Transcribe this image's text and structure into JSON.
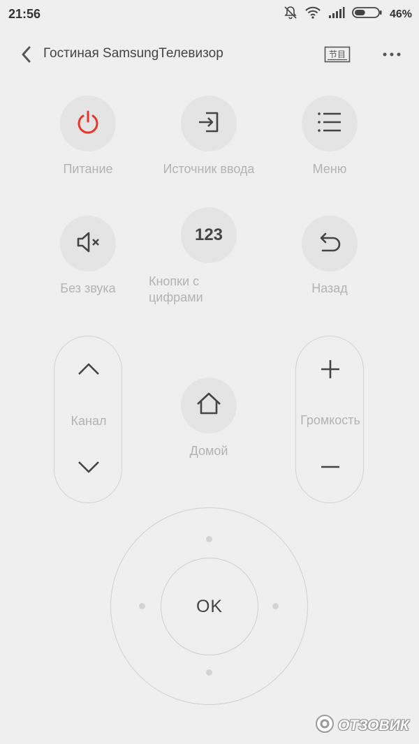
{
  "status_bar": {
    "time": "21:56",
    "battery_percent": "46%",
    "battery_level": 0.46,
    "icons": [
      "mute-bell-icon",
      "wifi-icon",
      "signal-icon",
      "battery-icon"
    ]
  },
  "header": {
    "title": "Гостиная SamsungТелевизор",
    "guide_label": "节目",
    "icons": [
      "back-icon",
      "guide-icon",
      "more-icon"
    ]
  },
  "buttons": {
    "power": {
      "label": "Питание",
      "icon": "power-icon",
      "color": "#e8352a"
    },
    "input": {
      "label": "Источник ввода",
      "icon": "input-source-icon"
    },
    "menu": {
      "label": "Меню",
      "icon": "menu-icon"
    },
    "mute": {
      "label": "Без звука",
      "icon": "mute-icon"
    },
    "numbers": {
      "label": "Кнопки с цифрами",
      "icon_text": "123"
    },
    "back": {
      "label": "Назад",
      "icon": "return-icon"
    },
    "home": {
      "label": "Домой",
      "icon": "home-icon"
    }
  },
  "channel": {
    "label": "Канал",
    "icons": [
      "chevron-up-icon",
      "chevron-down-icon"
    ]
  },
  "volume": {
    "label": "Громкость",
    "icons": [
      "plus-icon",
      "minus-icon"
    ]
  },
  "dpad": {
    "ok_label": "OK"
  },
  "watermark": {
    "text": "ОТЗОВИК"
  }
}
